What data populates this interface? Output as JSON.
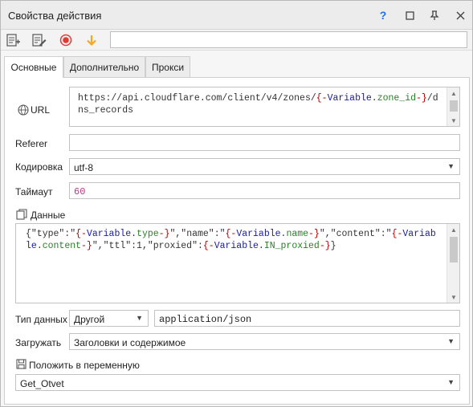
{
  "window": {
    "title": "Свойства действия"
  },
  "titlebar_buttons": {
    "help": "?",
    "maximize": "☐",
    "pin": "⊥",
    "close": "✕"
  },
  "toolbar": {
    "input_value": ""
  },
  "tabs": [
    {
      "label": "Основные",
      "active": true
    },
    {
      "label": "Дополнительно",
      "active": false
    },
    {
      "label": "Прокси",
      "active": false
    }
  ],
  "url": {
    "label": "URL",
    "icon_text": "www",
    "value_prefix": "https://api.cloudflare.com/client/v4/zones/",
    "var_open": "{-",
    "var_name": "Variable",
    "var_dot": ".",
    "var_prop": "zone_id",
    "var_close": "-}",
    "value_suffix": "/dns_records"
  },
  "referer": {
    "label": "Referer",
    "value": ""
  },
  "encoding": {
    "label": "Кодировка",
    "value": "utf-8"
  },
  "timeout": {
    "label": "Таймаут",
    "value": "60"
  },
  "data": {
    "label": "Данные",
    "segments": [
      {
        "t": "{\"type\":\"",
        "c": "plain"
      },
      {
        "t": "{-",
        "c": "var"
      },
      {
        "t": "Variable",
        "c": "vname"
      },
      {
        "t": ".",
        "c": "plain"
      },
      {
        "t": "type",
        "c": "vprop"
      },
      {
        "t": "-}",
        "c": "var"
      },
      {
        "t": "\",\"name\":\"",
        "c": "plain"
      },
      {
        "t": "{-",
        "c": "var"
      },
      {
        "t": "Variable",
        "c": "vname"
      },
      {
        "t": ".",
        "c": "plain"
      },
      {
        "t": "name",
        "c": "vprop"
      },
      {
        "t": "-}",
        "c": "var"
      },
      {
        "t": "\",\"content\":\"",
        "c": "plain"
      },
      {
        "t": "{-",
        "c": "var"
      },
      {
        "t": "Variable",
        "c": "vname"
      },
      {
        "t": ".",
        "c": "plain"
      },
      {
        "t": "content",
        "c": "vprop"
      },
      {
        "t": "-}",
        "c": "var"
      },
      {
        "t": "\",\"ttl\":1,\"proxied\":",
        "c": "plain"
      },
      {
        "t": "{-",
        "c": "var"
      },
      {
        "t": "Variable",
        "c": "vname"
      },
      {
        "t": ".",
        "c": "plain"
      },
      {
        "t": "IN_proxied",
        "c": "vprop"
      },
      {
        "t": "-}",
        "c": "var"
      },
      {
        "t": "}",
        "c": "plain"
      }
    ]
  },
  "data_type": {
    "label": "Тип данных",
    "type_value": "Другой",
    "content_type": "application/json"
  },
  "load": {
    "label": "Загружать",
    "value": "Заголовки и содержимое"
  },
  "save_to_var": {
    "label": "Положить в переменную",
    "value": "Get_Otvet"
  },
  "colors": {
    "record": "#e53935",
    "arrow": "#f5a623",
    "help": "#1a73e8",
    "tab_active": "#ffffff"
  }
}
